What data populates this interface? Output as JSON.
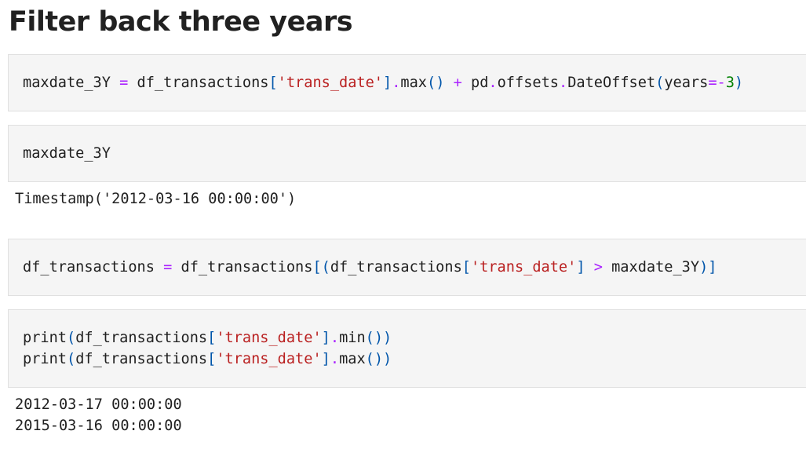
{
  "heading": "Filter back three years",
  "cells": [
    {
      "code_lines": [
        [
          {
            "t": "maxdate_3Y ",
            "c": ""
          },
          {
            "t": "=",
            "c": "op"
          },
          {
            "t": " df_transactions",
            "c": ""
          },
          {
            "t": "[",
            "c": "pu"
          },
          {
            "t": "'trans_date'",
            "c": "st"
          },
          {
            "t": "]",
            "c": "pu"
          },
          {
            "t": ".",
            "c": "op"
          },
          {
            "t": "max",
            "c": ""
          },
          {
            "t": "()",
            "c": "pu"
          },
          {
            "t": " ",
            "c": ""
          },
          {
            "t": "+",
            "c": "op"
          },
          {
            "t": " pd",
            "c": ""
          },
          {
            "t": ".",
            "c": "op"
          },
          {
            "t": "offsets",
            "c": ""
          },
          {
            "t": ".",
            "c": "op"
          },
          {
            "t": "DateOffset",
            "c": ""
          },
          {
            "t": "(",
            "c": "pu"
          },
          {
            "t": "years",
            "c": ""
          },
          {
            "t": "=-",
            "c": "op"
          },
          {
            "t": "3",
            "c": "nm"
          },
          {
            "t": ")",
            "c": "pu"
          }
        ]
      ],
      "output_lines": []
    },
    {
      "code_lines": [
        [
          {
            "t": "maxdate_3Y",
            "c": ""
          }
        ]
      ],
      "output_lines": [
        "Timestamp('2012-03-16 00:00:00')"
      ]
    },
    {
      "code_lines": [
        [
          {
            "t": "df_transactions ",
            "c": ""
          },
          {
            "t": "=",
            "c": "op"
          },
          {
            "t": " df_transactions",
            "c": ""
          },
          {
            "t": "[(",
            "c": "pu"
          },
          {
            "t": "df_transactions",
            "c": ""
          },
          {
            "t": "[",
            "c": "pu"
          },
          {
            "t": "'trans_date'",
            "c": "st"
          },
          {
            "t": "]",
            "c": "pu"
          },
          {
            "t": " ",
            "c": ""
          },
          {
            "t": ">",
            "c": "op"
          },
          {
            "t": " maxdate_3Y",
            "c": ""
          },
          {
            "t": ")]",
            "c": "pu"
          }
        ]
      ],
      "output_lines": []
    },
    {
      "code_lines": [
        [
          {
            "t": "print",
            "c": ""
          },
          {
            "t": "(",
            "c": "pu"
          },
          {
            "t": "df_transactions",
            "c": ""
          },
          {
            "t": "[",
            "c": "pu"
          },
          {
            "t": "'trans_date'",
            "c": "st"
          },
          {
            "t": "]",
            "c": "pu"
          },
          {
            "t": ".",
            "c": "op"
          },
          {
            "t": "min",
            "c": ""
          },
          {
            "t": "())",
            "c": "pu"
          }
        ],
        [
          {
            "t": "print",
            "c": ""
          },
          {
            "t": "(",
            "c": "pu"
          },
          {
            "t": "df_transactions",
            "c": ""
          },
          {
            "t": "[",
            "c": "pu"
          },
          {
            "t": "'trans_date'",
            "c": "st"
          },
          {
            "t": "]",
            "c": "pu"
          },
          {
            "t": ".",
            "c": "op"
          },
          {
            "t": "max",
            "c": ""
          },
          {
            "t": "())",
            "c": "pu"
          }
        ]
      ],
      "output_lines": [
        "2012-03-17 00:00:00",
        "2015-03-16 00:00:00"
      ]
    }
  ]
}
